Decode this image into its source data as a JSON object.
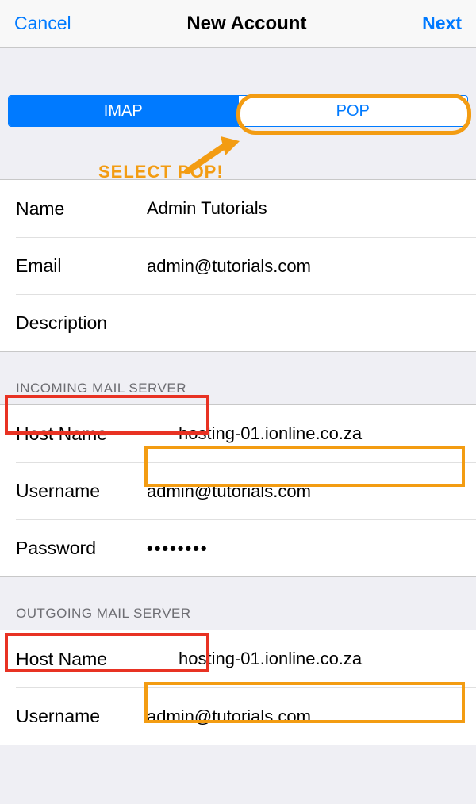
{
  "nav": {
    "cancel": "Cancel",
    "title": "New Account",
    "next": "Next"
  },
  "segmented": {
    "imap": "IMAP",
    "pop": "POP"
  },
  "callout": {
    "select_pop": "SELECT POP!"
  },
  "account": {
    "name_label": "Name",
    "name_value": "Admin Tutorials",
    "email_label": "Email",
    "email_value": "admin@tutorials.com",
    "description_label": "Description",
    "description_value": ""
  },
  "incoming": {
    "header": "INCOMING MAIL SERVER",
    "host_label": "Host Name",
    "host_value": "hosting-01.ionline.co.za",
    "user_label": "Username",
    "user_value": "admin@tutorials.com",
    "pw_label": "Password",
    "pw_value": "••••••••"
  },
  "outgoing": {
    "header": "OUTGOING MAIL SERVER",
    "host_label": "Host Name",
    "host_value": "hosting-01.ionline.co.za",
    "user_label": "Username",
    "user_value": "admin@tutorials.com"
  }
}
